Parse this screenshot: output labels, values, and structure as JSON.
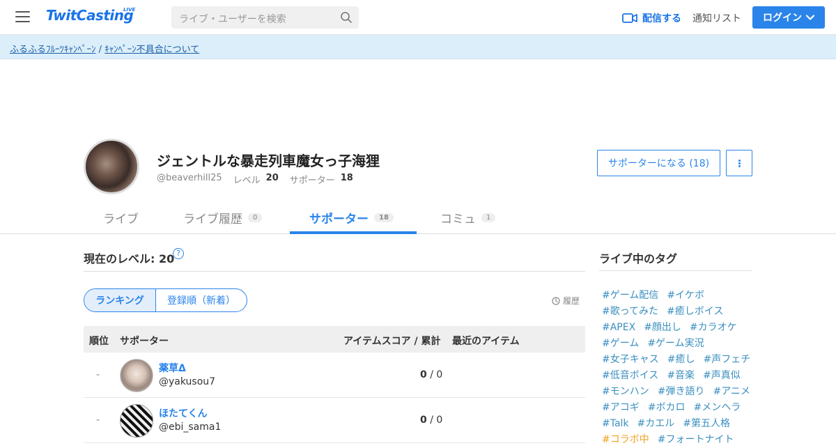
{
  "header": {
    "logo": "TwitCasting",
    "logo_tag": "LIVE",
    "search_placeholder": "ライブ・ユーザーを検索",
    "broadcast_label": "配信する",
    "notify_label": "通知リスト",
    "login_label": "ログイン"
  },
  "notice": {
    "campaign_link": "ふるふるﾌﾙｰﾂｷｬﾝﾍﾟｰﾝ",
    "separator": " / ",
    "issue_link": "ｷｬﾝﾍﾟｰﾝ不具合について"
  },
  "profile": {
    "name": "ジェントルな暴走列車魔女っ子海狸",
    "handle": "@beaverhill25",
    "level_label": "レベル",
    "level_value": "20",
    "supporter_label": "サポーター",
    "supporter_value": "18",
    "supporter_button": "サポーターになる (18)"
  },
  "tabs": [
    {
      "label": "ライブ",
      "badge": ""
    },
    {
      "label": "ライブ履歴",
      "badge": "0"
    },
    {
      "label": "サポーター",
      "badge": "18"
    },
    {
      "label": "コミュ",
      "badge": "1"
    }
  ],
  "main": {
    "level_title": "現在のレベル: 20",
    "help": "?",
    "seg_ranking": "ランキング",
    "seg_registration": "登録順（新着）",
    "history": "履歴",
    "table": {
      "columns": [
        "順位",
        "サポーター",
        "アイテムスコア / 累計",
        "最近のアイテム"
      ],
      "rows": [
        {
          "rank": "-",
          "name": "薬草Δ",
          "handle": "@yakusou7",
          "score": "0",
          "total": "0"
        },
        {
          "rank": "-",
          "name": "ほたてくん",
          "handle": "@ebi_sama1",
          "score": "0",
          "total": "0"
        }
      ]
    }
  },
  "sidebar": {
    "title": "ライブ中のタグ",
    "tag_lines": [
      [
        "#ゲーム配信",
        "#イケボ"
      ],
      [
        "#歌ってみた",
        "#癒しボイス"
      ],
      [
        "#APEX",
        "#顔出し",
        "#カラオケ"
      ],
      [
        "#ゲーム",
        "#ゲーム実況"
      ],
      [
        "#女子キャス",
        "#癒し",
        "#声フェチ"
      ],
      [
        "#低音ボイス",
        "#音楽",
        "#声真似"
      ],
      [
        "#モンハン",
        "#弾き語り",
        "#アニメ"
      ],
      [
        "#アコギ",
        "#ボカロ",
        "#メンヘラ"
      ],
      [
        "#Talk",
        "#カエル",
        "#第五人格"
      ],
      [
        "#コラボ中",
        "#フォートナイト"
      ]
    ]
  }
}
